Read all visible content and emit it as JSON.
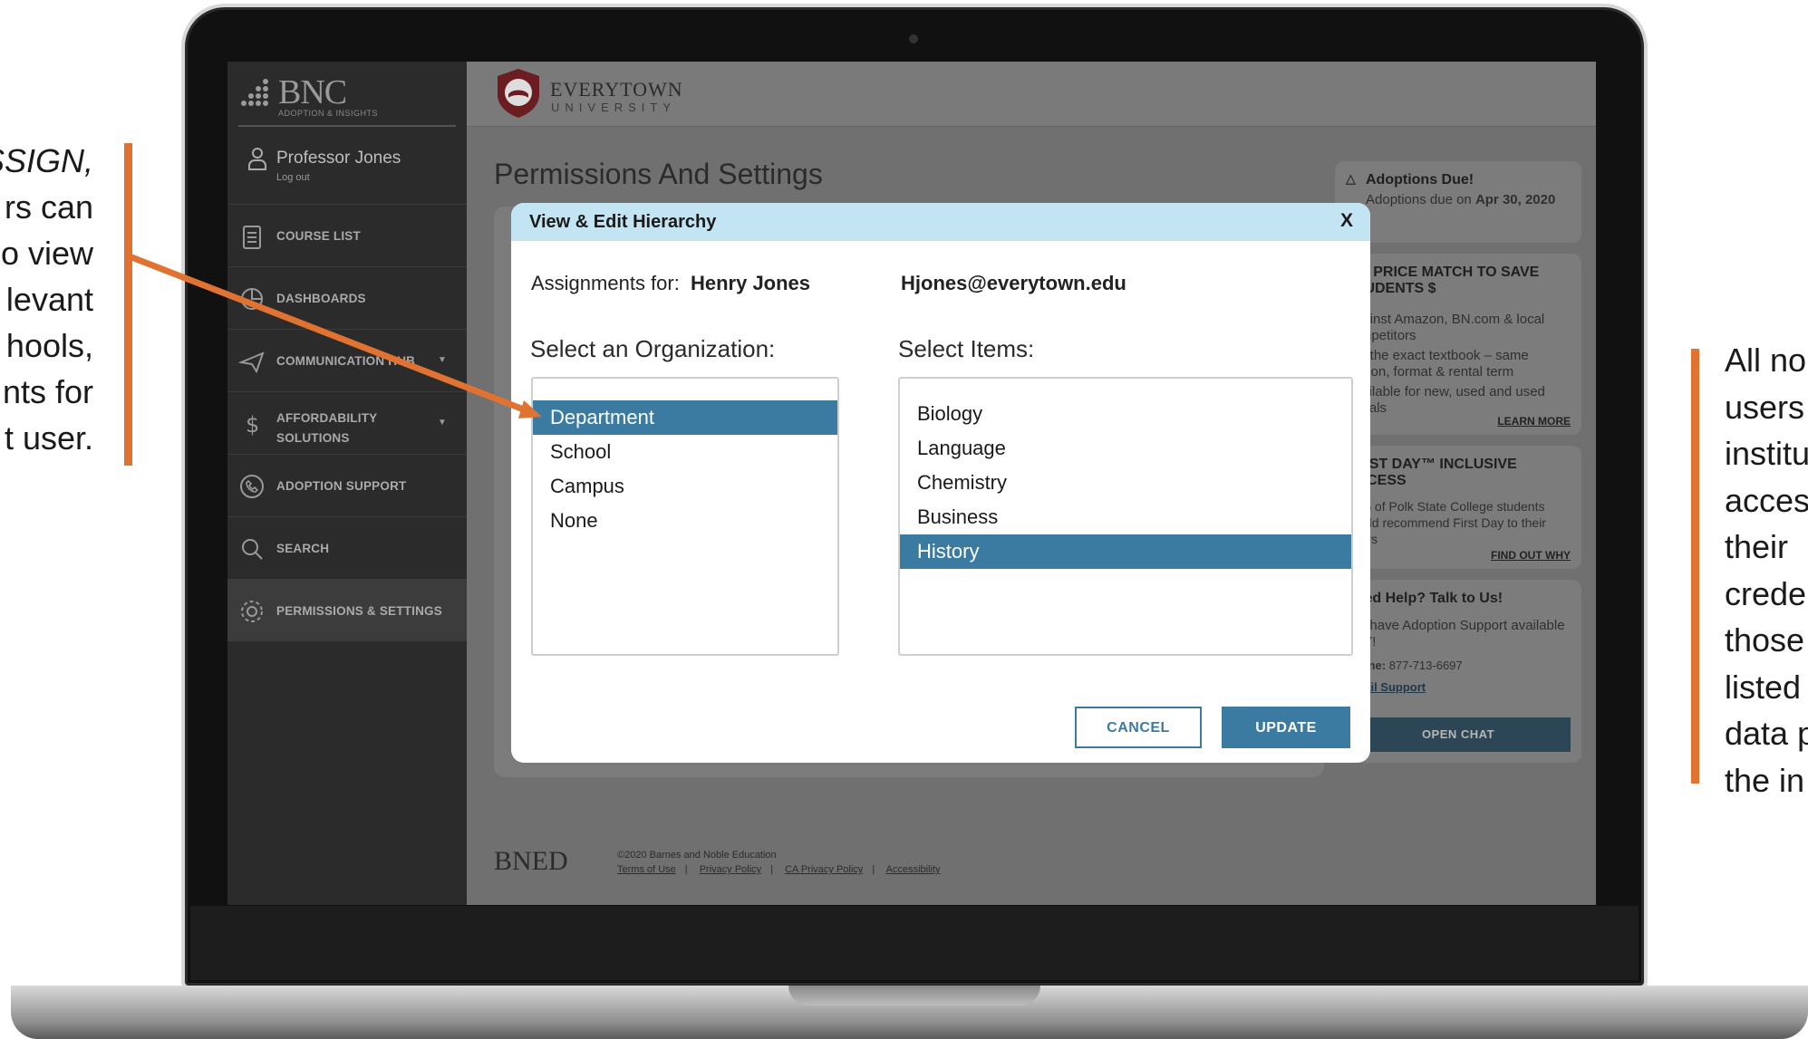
{
  "annotations": {
    "left_lines": [
      "SSIGN,",
      "rs can",
      "o view",
      "levant",
      "hools,",
      "nts for",
      "t user."
    ],
    "right_lines": [
      "All no",
      "users",
      "institu",
      "acces",
      "their",
      "crede",
      "those",
      "listed",
      "data p",
      "the in"
    ],
    "accent_color": "#e07332"
  },
  "sidebar": {
    "brand": {
      "name": "BNC",
      "tagline": "ADOPTION & INSIGHTS"
    },
    "collapse_icon": "chevron-left-icon",
    "user": {
      "name": "Professor Jones",
      "logout": "Log out"
    },
    "items": [
      {
        "label": "COURSE LIST",
        "icon": "clipboard-icon"
      },
      {
        "label": "DASHBOARDS",
        "icon": "pie-chart-icon"
      },
      {
        "label": "COMMUNICATION HUB",
        "icon": "paper-plane-icon",
        "caret": "▼"
      },
      {
        "label": "AFFORDABILITY SOLUTIONS",
        "icon": "dollar-icon",
        "caret": "▼"
      },
      {
        "label": "ADOPTION SUPPORT",
        "icon": "phone-icon"
      },
      {
        "label": "SEARCH",
        "icon": "search-icon"
      },
      {
        "label": "PERMISSIONS & SETTINGS",
        "icon": "gear-icon",
        "active": true
      }
    ]
  },
  "header": {
    "university_name": "EVERYTOWN",
    "university_sub": "UNIVERSITY"
  },
  "main": {
    "title": "Permissions And Settings"
  },
  "right_rail": {
    "adoptions": {
      "title": "Adoptions Due!",
      "text_prefix": "Adoptions due on",
      "date": "Apr 30, 2020"
    },
    "price_match": {
      "title": "WE PRICE MATCH TO SAVE STUDENTS $",
      "lines": [
        "Against Amazon, BN.com & local competitors",
        "For the exact textbook – same edition, format & rental term",
        "Available for new, used and used rentals"
      ],
      "link": "LEARN MORE"
    },
    "first_day": {
      "title": "FIRST DAY™ INCLUSIVE ACCESS",
      "text": "93% of Polk State College students would recommend First Day to their peers",
      "link": "FIND OUT WHY"
    },
    "help": {
      "title": "Need Help? Talk to Us!",
      "text": "We have Adoption Support available 24/7!",
      "phone_label": "Phone:",
      "phone": "877-713-6697",
      "email": "Email Support",
      "chat_button": "OPEN CHAT"
    }
  },
  "footer": {
    "logo": "BNED",
    "copyright": "©2020 Barnes and Noble Education",
    "links": [
      "Terms of Use",
      "Privacy Policy",
      "CA Privacy Policy",
      "Accessibility"
    ]
  },
  "modal": {
    "title": "View & Edit Hierarchy",
    "close": "X",
    "assignments_label": "Assignments for:",
    "assignee": "Henry Jones",
    "email": "Hjones@everytown.edu",
    "org_label": "Select an Organization:",
    "organizations": [
      "Department",
      "School",
      "Campus",
      "None"
    ],
    "selected_organization": "Department",
    "items_label": "Select Items:",
    "items": [
      "Biology",
      "Language",
      "Chemistry",
      "Business",
      "History"
    ],
    "selected_item": "History",
    "cancel": "CANCEL",
    "update": "UPDATE",
    "accent_color": "#3b7ba2",
    "header_color": "#c3e4f3"
  }
}
